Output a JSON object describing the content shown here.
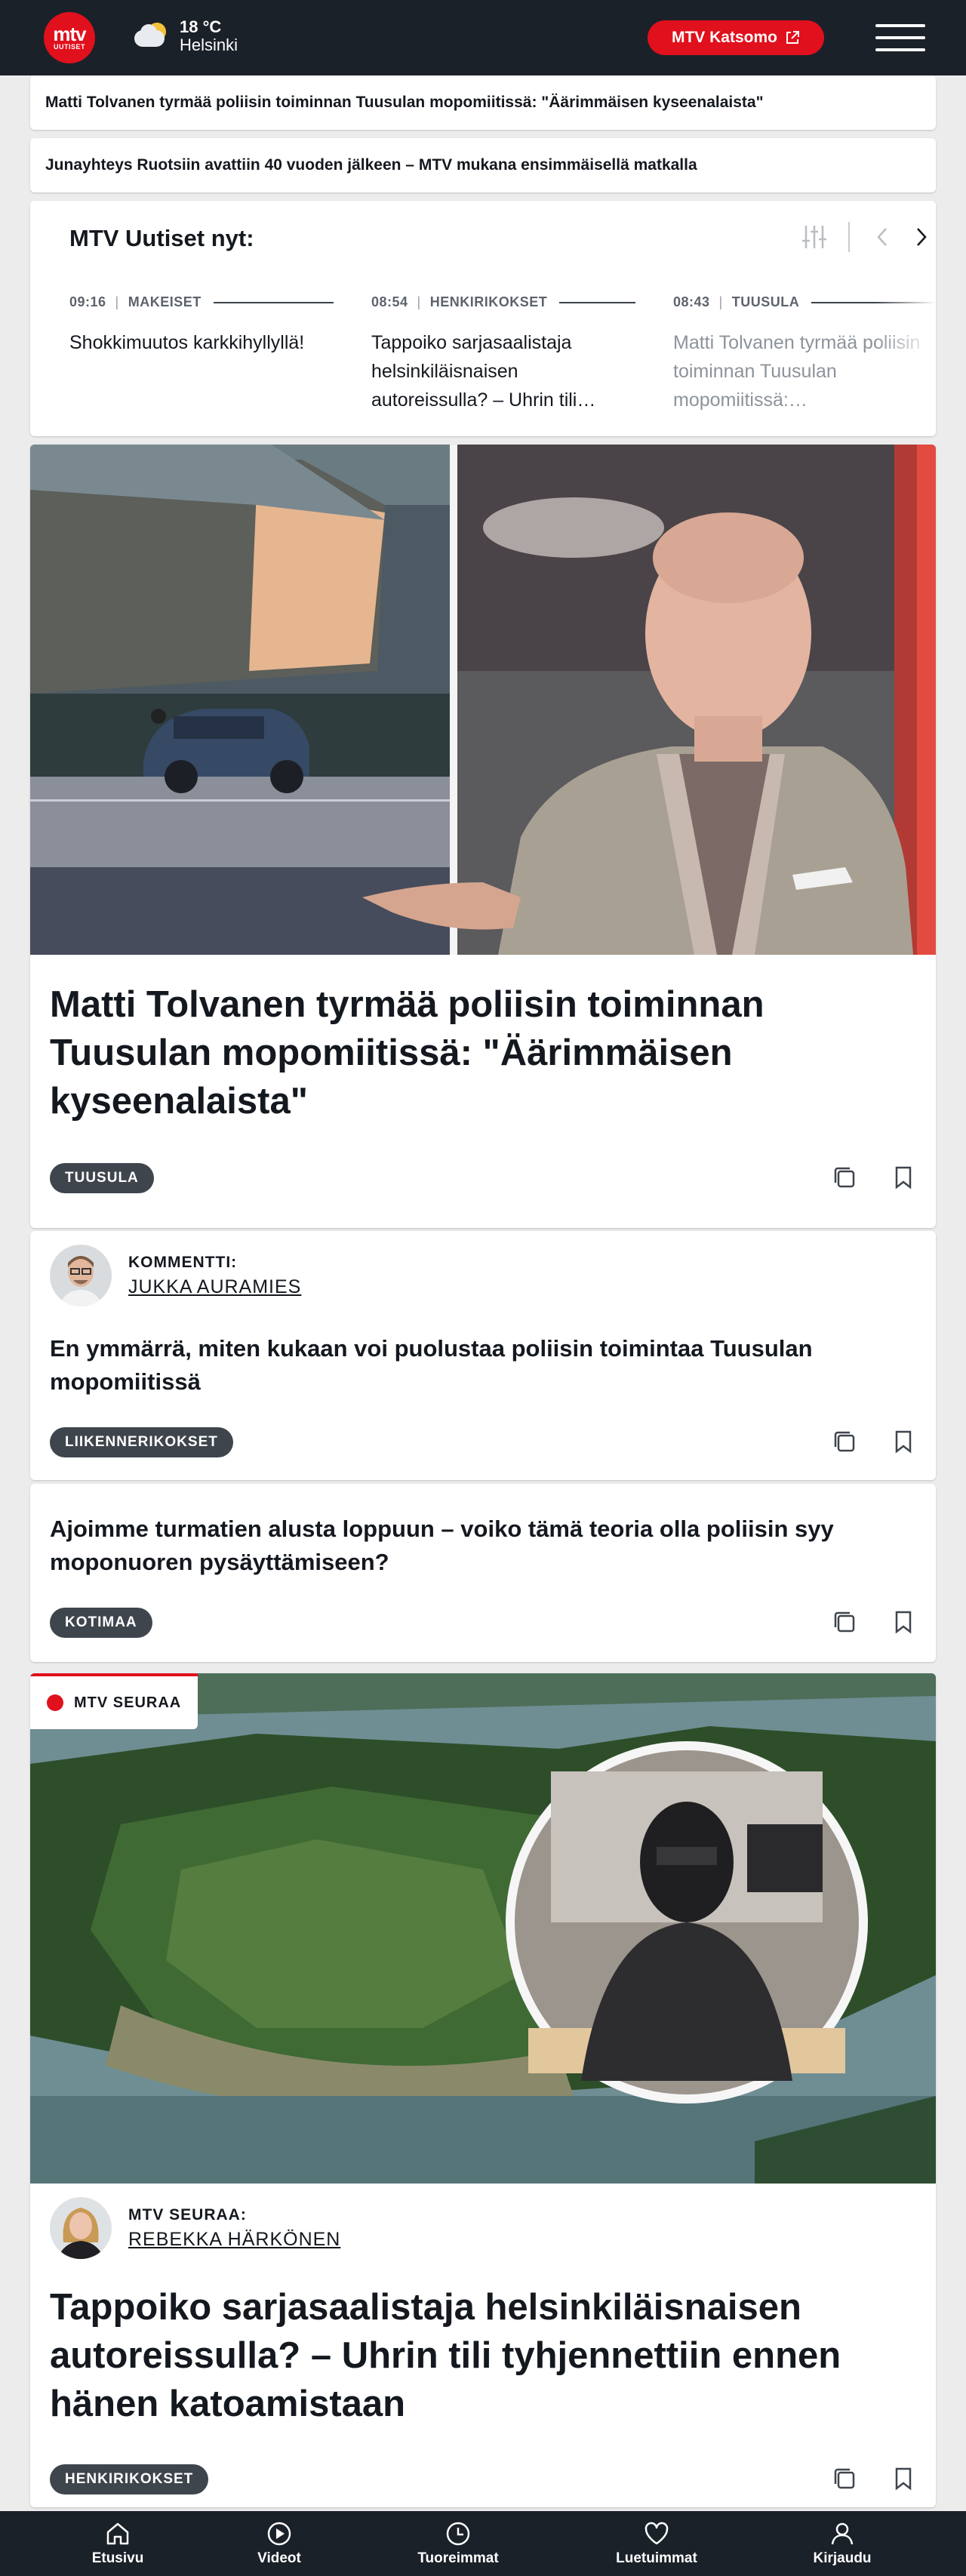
{
  "header": {
    "logo_top": "mtv",
    "logo_bottom": "UUTISET",
    "weather_temp": "18 °C",
    "weather_city": "Helsinki",
    "katsomo_label": "MTV Katsomo"
  },
  "tickers": [
    "Matti Tolvanen tyrmää poliisin toiminnan Tuusulan mopomiitissä: \"Äärimmäisen kyseenalaista\"",
    "Junayhteys Ruotsiin avattiin 40 vuoden jälkeen – MTV mukana ensimmäisellä matkalla"
  ],
  "now": {
    "title": "MTV Uutiset nyt:",
    "items": [
      {
        "time": "09:16",
        "category": "MAKEISET",
        "text": "Shokkimuutos karkkihyllyllä!"
      },
      {
        "time": "08:54",
        "category": "HENKIRIKOKSET",
        "text": "Tappoiko sarjasaalistaja helsinkiläisnaisen autoreissulla? – Uhrin tili…"
      },
      {
        "time": "08:43",
        "category": "TUUSULA",
        "text": "Matti Tolvanen tyrmää poliisin toiminnan Tuusulan mopomiitissä:…"
      }
    ]
  },
  "hero": {
    "headline": "Matti Tolvanen tyrmää poliisin toiminnan Tuusulan mopomiitissä: \"Äärimmäisen kyseenalaista\"",
    "tag": "TUUSULA"
  },
  "comment": {
    "kicker": "KOMMENTTI:",
    "author": "JUKKA AURAMIES",
    "headline": "En ymmärrä, miten kukaan voi puolustaa poliisin toimintaa Tuusulan mopomiitissä",
    "tag": "LIIKENNERIKOKSET"
  },
  "story3": {
    "headline": "Ajoimme turmatien alusta loppuun – voiko tämä teoria olla poliisin syy moponuoren pysäyttämiseen?",
    "tag": "KOTIMAA"
  },
  "seura": {
    "badge": "MTV SEURAA",
    "kicker": "MTV SEURAA:",
    "author": "REBEKKA HÄRKÖNEN",
    "headline": "Tappoiko sarjasaalistaja helsinkiläisnaisen autoreissulla? – Uhrin tili tyhjennettiin ennen hänen katoamistaan",
    "tag": "HENKIRIKOKSET"
  },
  "nav": {
    "items": [
      {
        "label": "Etusivu",
        "icon": "home-icon"
      },
      {
        "label": "Videot",
        "icon": "play-icon"
      },
      {
        "label": "Tuoreimmat",
        "icon": "clock-icon"
      },
      {
        "label": "Luetuimmat",
        "icon": "heart-icon"
      },
      {
        "label": "Kirjaudu",
        "icon": "user-icon"
      }
    ]
  },
  "colors": {
    "brand_red": "#e1101d",
    "header_bg": "#1b2129",
    "tag_bg": "#3f454d"
  }
}
